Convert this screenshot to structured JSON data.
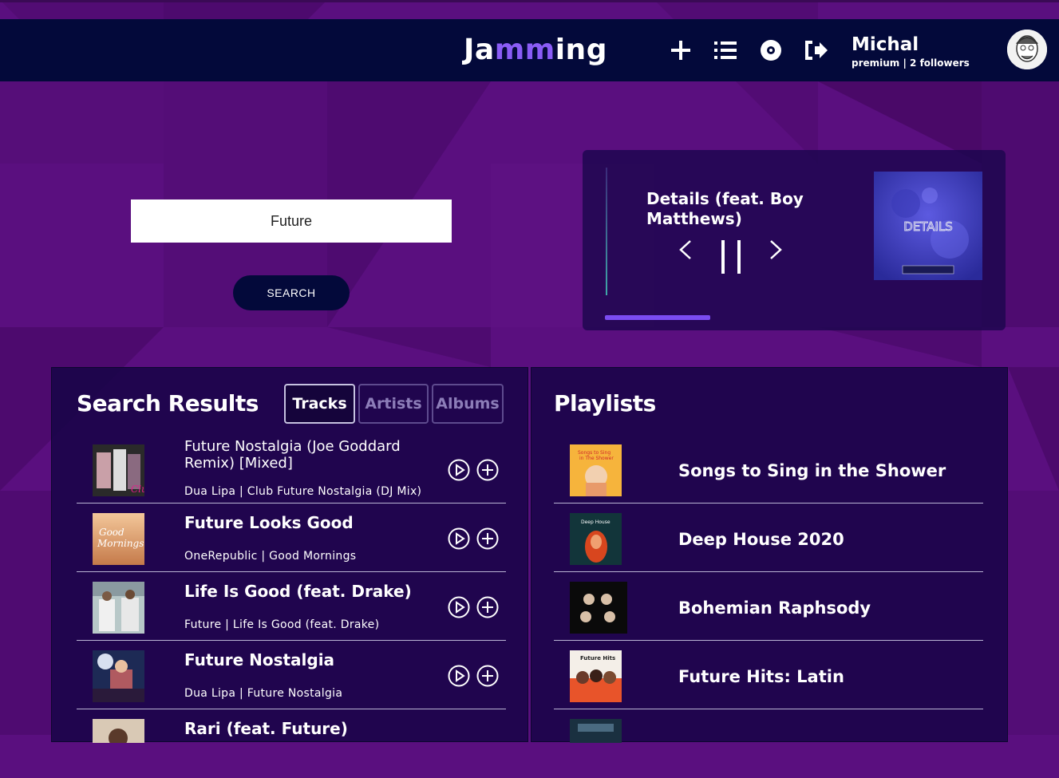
{
  "header": {
    "brand_start": "Ja",
    "brand_mid": "mm",
    "brand_end": "ing",
    "icons": [
      "plus-icon",
      "list-icon",
      "vinyl-icon",
      "logout-icon"
    ],
    "user_name": "Michal",
    "user_meta": "premium | 2 followers"
  },
  "search": {
    "value": "Future",
    "button_label": "SEARCH"
  },
  "player": {
    "track_title": "Details (feat. Boy Matthews)",
    "cover_text": "DETAILS",
    "progress": 0.28,
    "prev_icon": "chevron-left-icon",
    "pause_icon": "pause-icon",
    "next_icon": "chevron-right-icon"
  },
  "results": {
    "heading": "Search Results",
    "tabs": [
      "Tracks",
      "Artists",
      "Albums"
    ],
    "active_tab": "Tracks",
    "tracks": [
      {
        "title": "Future Nostalgia (Joe Goddard Remix) [Mixed]",
        "subtitle": "Dua Lipa | Club Future Nostalgia (DJ Mix)"
      },
      {
        "title": "Future Looks Good",
        "subtitle": "OneRepublic | Good Mornings"
      },
      {
        "title": "Life Is Good (feat. Drake)",
        "subtitle": "Future | Life Is Good (feat. Drake)"
      },
      {
        "title": "Future Nostalgia",
        "subtitle": "Dua Lipa | Future Nostalgia"
      },
      {
        "title": "Rari (feat. Future)",
        "subtitle": ""
      }
    ]
  },
  "playlists": {
    "heading": "Playlists",
    "items": [
      {
        "name": "Songs to Sing in the Shower"
      },
      {
        "name": "Deep House 2020"
      },
      {
        "name": "Bohemian Raphsody"
      },
      {
        "name": "Future Hits: Latin"
      }
    ]
  },
  "colors": {
    "background": "#5a0f7f",
    "header": "#03093a",
    "accent": "#8a5cf6",
    "panel": "#180548"
  }
}
